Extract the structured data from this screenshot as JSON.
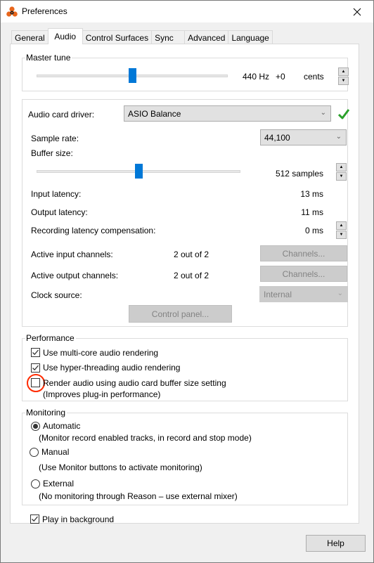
{
  "window": {
    "title": "Preferences"
  },
  "tabs": [
    {
      "label": "General",
      "active": false
    },
    {
      "label": "Audio",
      "active": true
    },
    {
      "label": "Control Surfaces",
      "active": false
    },
    {
      "label": "Sync",
      "active": false
    },
    {
      "label": "Advanced",
      "active": false
    },
    {
      "label": "Language",
      "active": false
    }
  ],
  "master_tune": {
    "label": "Master tune",
    "hz": "440 Hz",
    "offset": "+0",
    "unit": "cents",
    "slider_position": 0.5
  },
  "audio_device": {
    "driver_label": "Audio card driver:",
    "driver_value": "ASIO Balance",
    "driver_status": "ok",
    "status_color": "#2aa02a",
    "sample_rate_label": "Sample rate:",
    "sample_rate_value": "44,100",
    "buffer_size_label": "Buffer size:",
    "buffer_size_value": "512 samples",
    "buffer_slider_position": 0.5,
    "input_latency_label": "Input latency:",
    "input_latency_value": "13 ms",
    "output_latency_label": "Output latency:",
    "output_latency_value": "11 ms",
    "rec_comp_label": "Recording latency compensation:",
    "rec_comp_value": "0 ms",
    "active_inputs_label": "Active input channels:",
    "active_inputs_value": "2 out of 2",
    "active_outputs_label": "Active output channels:",
    "active_outputs_value": "2 out of 2",
    "channels_button": "Channels...",
    "clock_source_label": "Clock source:",
    "clock_source_value": "Internal",
    "control_panel_button": "Control panel..."
  },
  "performance": {
    "label": "Performance",
    "options": [
      {
        "label": "Use multi-core audio rendering",
        "checked": true
      },
      {
        "label": "Use hyper-threading audio rendering",
        "checked": true
      },
      {
        "label": "Render audio using audio card buffer size setting",
        "checked": false,
        "note": "(Improves plug-in performance)"
      }
    ]
  },
  "monitoring": {
    "label": "Monitoring",
    "options": [
      {
        "label": "Automatic",
        "selected": true,
        "note": "(Monitor record enabled tracks, in record and stop mode)"
      },
      {
        "label": "Manual",
        "selected": false,
        "note": "(Use Monitor buttons to activate monitoring)"
      },
      {
        "label": "External",
        "selected": false,
        "note": "(No monitoring through Reason – use external mixer)"
      }
    ]
  },
  "play_in_background": {
    "label": "Play in background",
    "checked": true
  },
  "footer": {
    "help_button": "Help"
  },
  "colors": {
    "accent": "#0078d7",
    "highlight_ring": "#ff2a00"
  }
}
